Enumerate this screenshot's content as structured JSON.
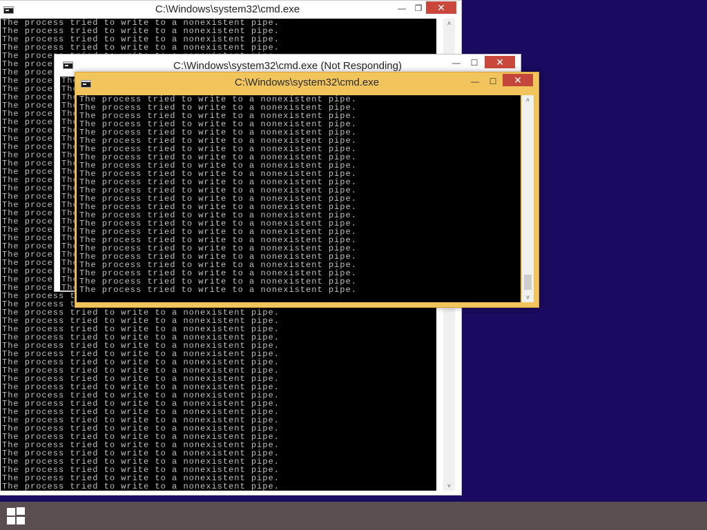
{
  "windows": {
    "back": {
      "title": "C:\\Windows\\system32\\cmd.exe",
      "controls": {
        "minimize": "—",
        "maximize": "❐",
        "close": "✕"
      }
    },
    "middle": {
      "title": "C:\\Windows\\system32\\cmd.exe (Not Responding)",
      "controls": {
        "minimize": "—",
        "maximize": "☐",
        "close": "✕"
      }
    },
    "front": {
      "title": "C:\\Windows\\system32\\cmd.exe",
      "controls": {
        "minimize": "—",
        "maximize": "☐",
        "close": "✕"
      }
    }
  },
  "console": {
    "message": "The process tried to write to a nonexistent pipe."
  },
  "scrollbar": {
    "up_arrow": "˄",
    "down_arrow": "˅"
  },
  "taskbar": {
    "start_icon": "windows-logo-icon"
  },
  "colors": {
    "desktop": "#1a0a60",
    "taskbar": "#5b4e51",
    "console_bg": "#000000",
    "console_text": "#c0c0c0",
    "active_frame": "#f1c55c",
    "close_button": "#c9483b"
  }
}
